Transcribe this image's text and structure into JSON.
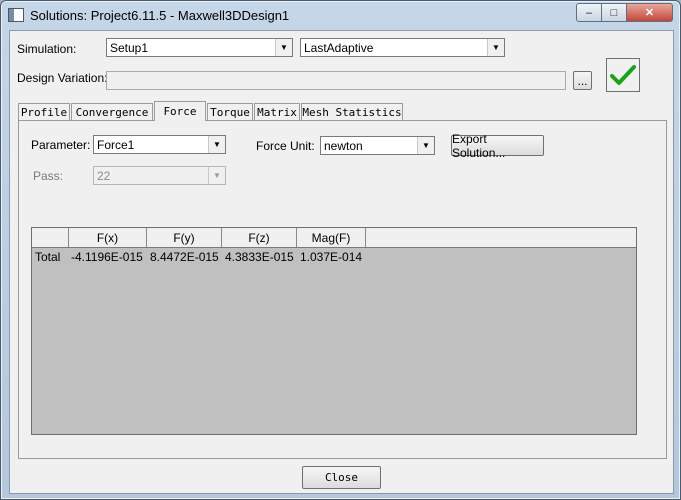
{
  "window": {
    "title": "Solutions: Project6.11.5 - Maxwell3DDesign1",
    "controls": {
      "minimize": "‒",
      "maximize": "□",
      "close": "✕"
    }
  },
  "simulation": {
    "label": "Simulation:",
    "setup_value": "Setup1",
    "pass_type_value": "LastAdaptive"
  },
  "design_variation": {
    "label": "Design Variation:",
    "value": "",
    "browse_label": "..."
  },
  "tabs": [
    {
      "label": "Profile"
    },
    {
      "label": "Convergence"
    },
    {
      "label": "Force"
    },
    {
      "label": "Torque"
    },
    {
      "label": "Matrix"
    },
    {
      "label": "Mesh Statistics"
    }
  ],
  "active_tab": "Force",
  "force": {
    "parameter_label": "Parameter:",
    "parameter_value": "Force1",
    "force_unit_label": "Force Unit:",
    "force_unit_value": "newton",
    "export_button": "Export Solution...",
    "pass_label": "Pass:",
    "pass_value": "22"
  },
  "table": {
    "columns": [
      "",
      "F(x)",
      "F(y)",
      "F(z)",
      "Mag(F)"
    ],
    "rows": [
      {
        "name": "Total",
        "fx": "-4.1196E-015",
        "fy": "8.4472E-015",
        "fz": "4.3833E-015",
        "mag": "1.037E-014"
      }
    ]
  },
  "close_button": "Close",
  "colors": {
    "checkmark": "#1aa31a",
    "grid_background": "#c0c0c0",
    "dialog_background": "#f0f0f0"
  }
}
